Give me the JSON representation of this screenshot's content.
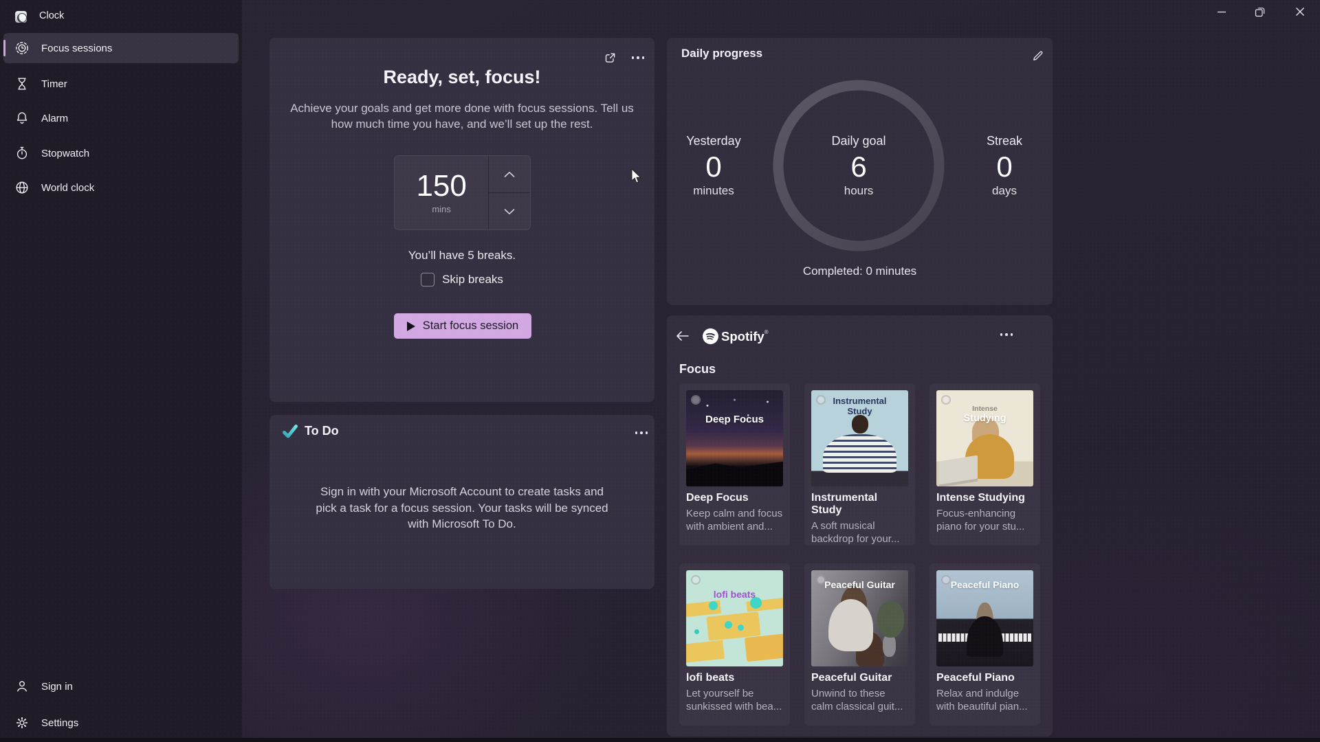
{
  "titlebar": {
    "app_title": "Clock"
  },
  "sidebar": {
    "items": [
      {
        "label": "Focus sessions",
        "selected": true
      },
      {
        "label": "Timer"
      },
      {
        "label": "Alarm"
      },
      {
        "label": "Stopwatch"
      },
      {
        "label": "World clock"
      }
    ],
    "footer": [
      {
        "label": "Sign in"
      },
      {
        "label": "Settings"
      }
    ]
  },
  "focus_card": {
    "title": "Ready, set, focus!",
    "subtitle_line1": "Achieve your goals and get more done with focus sessions. Tell us",
    "subtitle_line2": "how much time you have, and we’ll set up the rest.",
    "minutes_value": "150",
    "minutes_unit": "mins",
    "breaks_text": "You’ll have 5 breaks.",
    "skip_breaks_label": "Skip breaks",
    "start_button_label": "Start focus session"
  },
  "todo_card": {
    "title": "To Do",
    "body_line1": "Sign in with your Microsoft Account to create tasks and",
    "body_line2": "pick a task for a focus session. Your tasks will be synced",
    "body_line3": "with Microsoft To Do."
  },
  "daily_progress": {
    "title": "Daily progress",
    "stats": [
      {
        "label": "Yesterday",
        "value": "0",
        "unit": "minutes"
      },
      {
        "label": "Daily goal",
        "value": "6",
        "unit": "hours"
      },
      {
        "label": "Streak",
        "value": "0",
        "unit": "days"
      }
    ],
    "completed_text": "Completed: 0 minutes"
  },
  "spotify_card": {
    "brand": "Spotify",
    "brand_mark": "®",
    "section_title": "Focus",
    "tiles": [
      {
        "title": "Deep Focus",
        "description": "Keep calm and focus with ambient and...",
        "art": "deep-focus",
        "art_label": "Deep Focus"
      },
      {
        "title": "Instrumental Study",
        "description": "A soft musical backdrop for your...",
        "art": "instrumental-study",
        "art_label": "Instrumental Study"
      },
      {
        "title": "Intense Studying",
        "description": "Focus-enhancing piano for your stu...",
        "art": "intense-studying",
        "art_label": "Studying",
        "art_label_small": "Intense"
      },
      {
        "title": "lofi beats",
        "description": "Let yourself be sunkissed with bea...",
        "art": "lofi-beats",
        "art_label": "lofi beats"
      },
      {
        "title": "Peaceful Guitar",
        "description": "Unwind to these calm classical guit...",
        "art": "peaceful-guitar",
        "art_label": "Peaceful Guitar"
      },
      {
        "title": "Peaceful Piano",
        "description": "Relax and indulge with beautiful pian...",
        "art": "peaceful-piano",
        "art_label": "Peaceful Piano"
      }
    ]
  },
  "colors": {
    "accent": "#d3a3e3",
    "start_button": "#d2a8e3",
    "todo_check": "#3fd0c9",
    "card_background": "#343041",
    "sidebar_background": "#1f1b27"
  }
}
